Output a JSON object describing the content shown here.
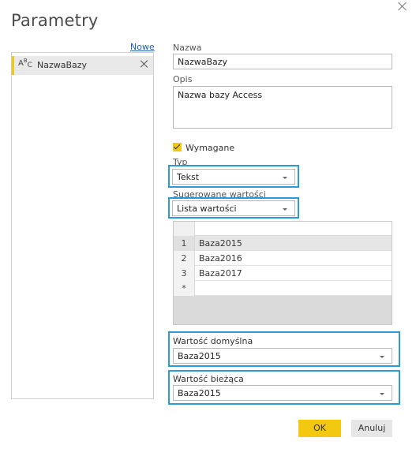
{
  "dialog": {
    "title": "Parametry"
  },
  "left": {
    "new_link": "Nowe",
    "items": [
      {
        "icon": "abc-text-type-icon",
        "icon_text": "ABC",
        "label": "NazwaBazy"
      }
    ]
  },
  "form": {
    "name_label": "Nazwa",
    "name_value": "NazwaBazy",
    "description_label": "Opis",
    "description_value": "Nazwa bazy Access",
    "required_label": "Wymagane",
    "required_checked": true,
    "type_label": "Typ",
    "type_value": "Tekst",
    "suggested_label": "Sugerowane wartości",
    "suggested_value": "Lista wartości",
    "values_table": {
      "rows": [
        {
          "num": "1",
          "value": "Baza2015"
        },
        {
          "num": "2",
          "value": "Baza2016"
        },
        {
          "num": "3",
          "value": "Baza2017"
        },
        {
          "num": "*",
          "value": ""
        }
      ]
    },
    "default_label": "Wartość domyślna",
    "default_value": "Baza2015",
    "current_label": "Wartość bieżąca",
    "current_value": "Baza2015"
  },
  "buttons": {
    "ok": "OK",
    "cancel": "Anuluj"
  },
  "colors": {
    "accent": "#f2c811",
    "highlight": "#2a9bd6",
    "link": "#1f5fb0"
  }
}
